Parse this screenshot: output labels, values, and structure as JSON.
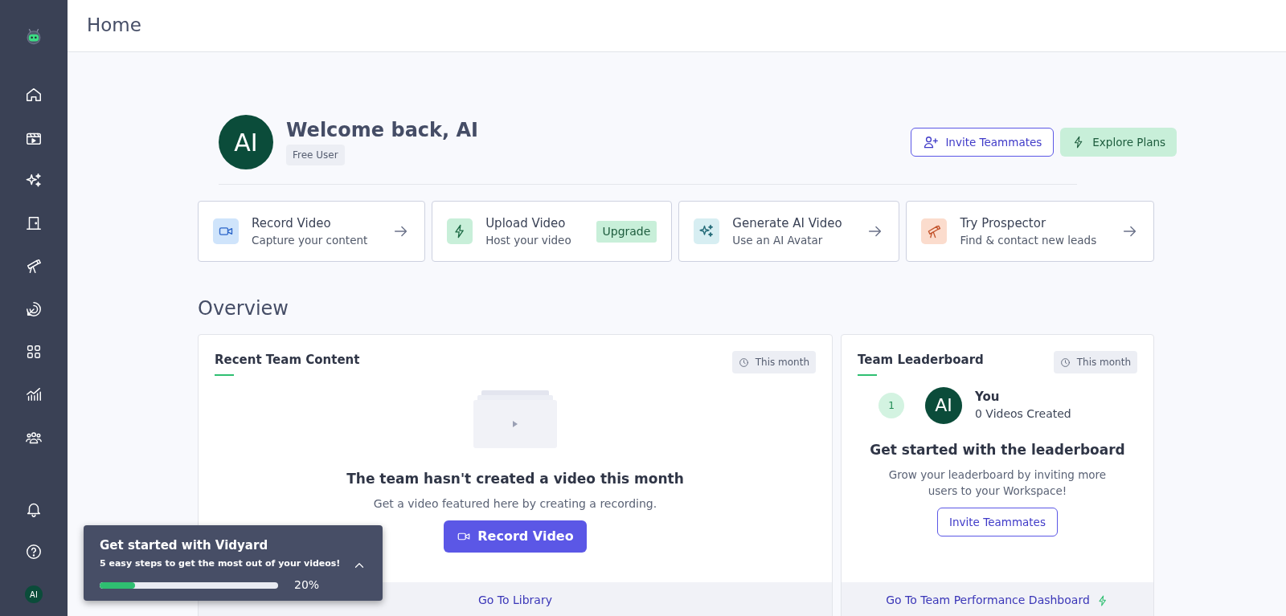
{
  "sidebar": {
    "avatar": "AI"
  },
  "header": {
    "title": "Home"
  },
  "welcome": {
    "avatar": "AI",
    "title": "Welcome back, AI",
    "badge": "Free User",
    "buttons": [
      {
        "kind": "outline",
        "label": "Invite Teammates"
      },
      {
        "kind": "soft",
        "label": "Explore Plans"
      }
    ]
  },
  "quick_actions": [
    {
      "kind": "record",
      "title": "Record Video",
      "subtitle": "Capture your content"
    },
    {
      "kind": "upload",
      "title": "Upload Video",
      "subtitle": "Host your video",
      "badge": "Upgrade"
    },
    {
      "kind": "generate",
      "title": "Generate AI Video",
      "subtitle": "Use an AI Avatar"
    },
    {
      "kind": "prospector",
      "title": "Try Prospector",
      "subtitle": "Find & contact new leads"
    }
  ],
  "overview": {
    "title": "Overview",
    "recent": {
      "title": "Recent Team Content",
      "period": "This month",
      "empty_title": "The team hasn't created a video this month",
      "empty_text": "Get a video featured here by creating a recording.",
      "button": "Record Video",
      "footer_link": "Go To Library"
    },
    "leaderboard": {
      "title": "Team Leaderboard",
      "period": "This month",
      "entries": [
        {
          "rank": "1",
          "avatar": "AI",
          "name": "You",
          "detail": "0 Videos Created"
        }
      ],
      "cta_title": "Get started with the leaderboard",
      "cta_text": "Grow your leaderboard by inviting more users to your Workspace!",
      "button": "Invite Teammates",
      "footer_link": "Go To Team Performance Dashboard"
    }
  },
  "onboarding": {
    "title": "Get started with Vidyard",
    "subtitle": "5 easy steps to get the most out of your videos!",
    "level": 0.2,
    "reading": "20%"
  }
}
